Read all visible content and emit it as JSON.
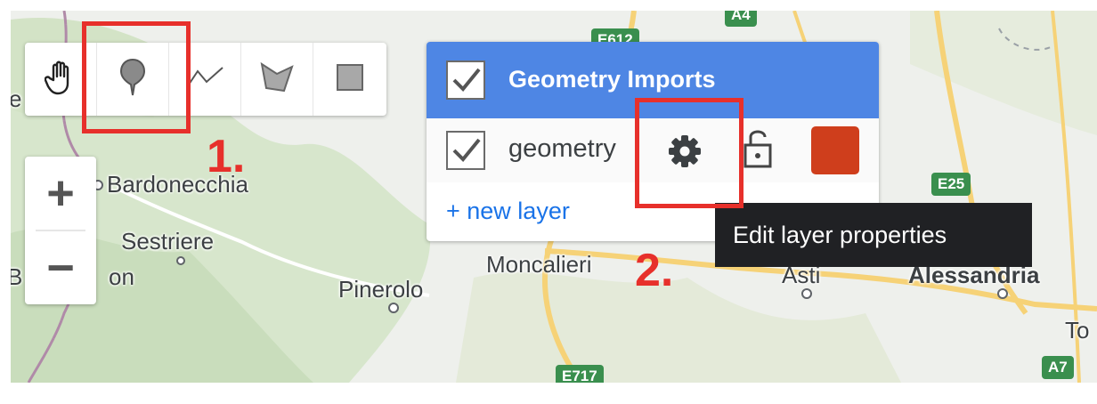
{
  "map": {
    "places": {
      "bardonecchia": "Bardonecchia",
      "sestriere": "Sestriere",
      "pinerolo": "Pinerolo",
      "moncalieri": "Moncalieri",
      "asti": "Asti",
      "alessandria": "Alessandria",
      "left_edge_e": "e",
      "left_edge_b": "B",
      "on_fragment": "on",
      "to_fragment": "To"
    },
    "road_shields": {
      "a4": "A4",
      "e612": "E612",
      "e25": "E25",
      "e717": "E717",
      "a7": "A7"
    }
  },
  "drawing_tools": [
    {
      "name": "pan",
      "icon": "hand-icon"
    },
    {
      "name": "marker",
      "icon": "map-pin-icon"
    },
    {
      "name": "line",
      "icon": "polyline-icon"
    },
    {
      "name": "polygon",
      "icon": "polygon-icon"
    },
    {
      "name": "rectangle",
      "icon": "rectangle-icon"
    }
  ],
  "zoom": {
    "in_label": "+",
    "out_label": "−"
  },
  "imports_panel": {
    "title": "Geometry Imports",
    "layer": {
      "name": "geometry",
      "settings_icon": "gear-icon",
      "lock_icon": "unlock-icon",
      "color": "#cf3e1c"
    },
    "new_layer_label": "+ new layer"
  },
  "tooltip": "Edit layer properties",
  "annotations": {
    "step1": "1.",
    "step2": "2.",
    "color": "#e7302b"
  },
  "colors": {
    "panel_header": "#4e86e4",
    "link": "#1a73e8"
  }
}
